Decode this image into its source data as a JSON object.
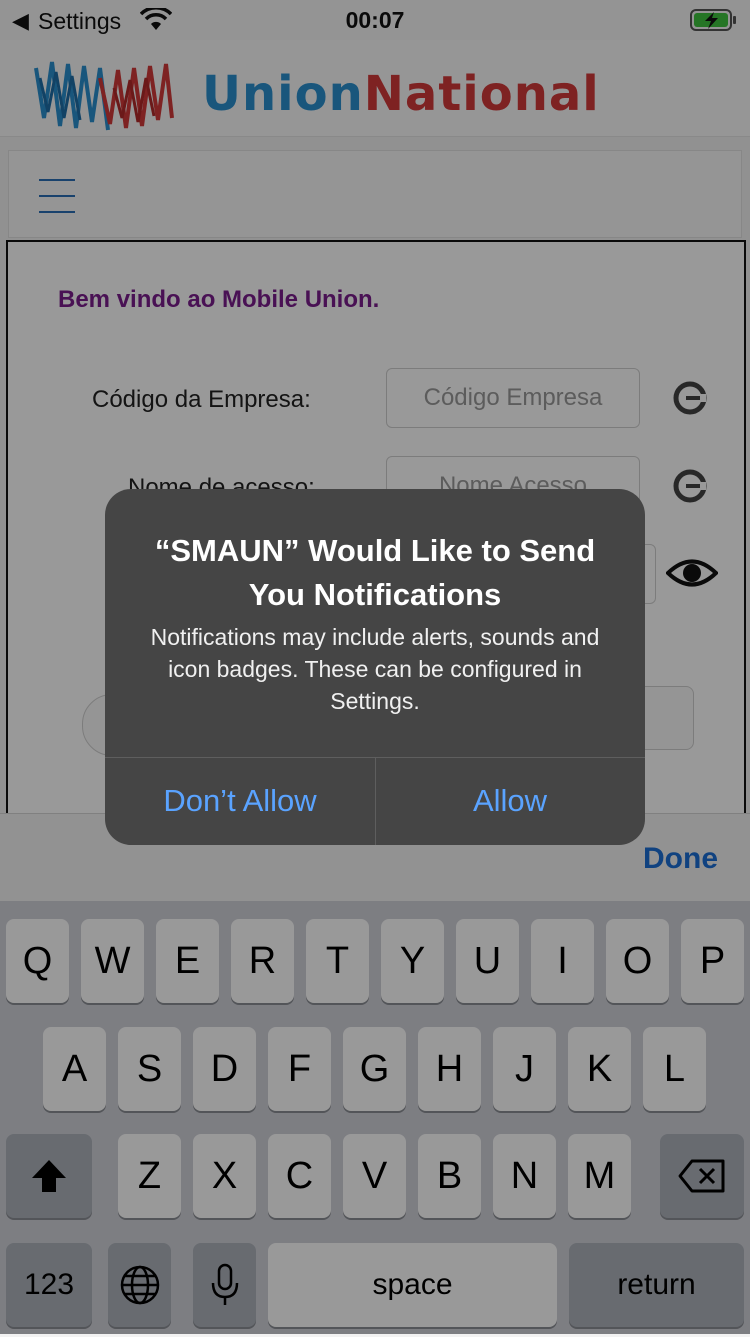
{
  "status_bar": {
    "back_label": "Settings",
    "time": "00:07"
  },
  "logo": {
    "union": "Union",
    "national": "National"
  },
  "form": {
    "welcome": "Bem vindo ao Mobile Union.",
    "company_label": "Código da Empresa:",
    "company_placeholder": "Código Empresa",
    "username_label": "Nome de acesso:",
    "username_placeholder": "Nome Acesso"
  },
  "accessory": {
    "done_label": "Done"
  },
  "keyboard": {
    "row1": [
      "Q",
      "W",
      "E",
      "R",
      "T",
      "Y",
      "U",
      "I",
      "O",
      "P"
    ],
    "row2": [
      "A",
      "S",
      "D",
      "F",
      "G",
      "H",
      "J",
      "K",
      "L"
    ],
    "row3": [
      "Z",
      "X",
      "C",
      "V",
      "B",
      "N",
      "M"
    ],
    "numbers_label": "123",
    "space_label": "space",
    "return_label": "return"
  },
  "alert": {
    "title": "“SMAUN” Would Like to Send You Notifications",
    "message": "Notifications may include alerts, sounds and icon badges. These can be configured in Settings.",
    "deny_label": "Don’t Allow",
    "allow_label": "Allow"
  },
  "colors": {
    "link_blue": "#5aa3ff",
    "welcome_purple": "#7a1d8c",
    "logo_blue": "#2a8fcf",
    "logo_red": "#d23a3a"
  }
}
